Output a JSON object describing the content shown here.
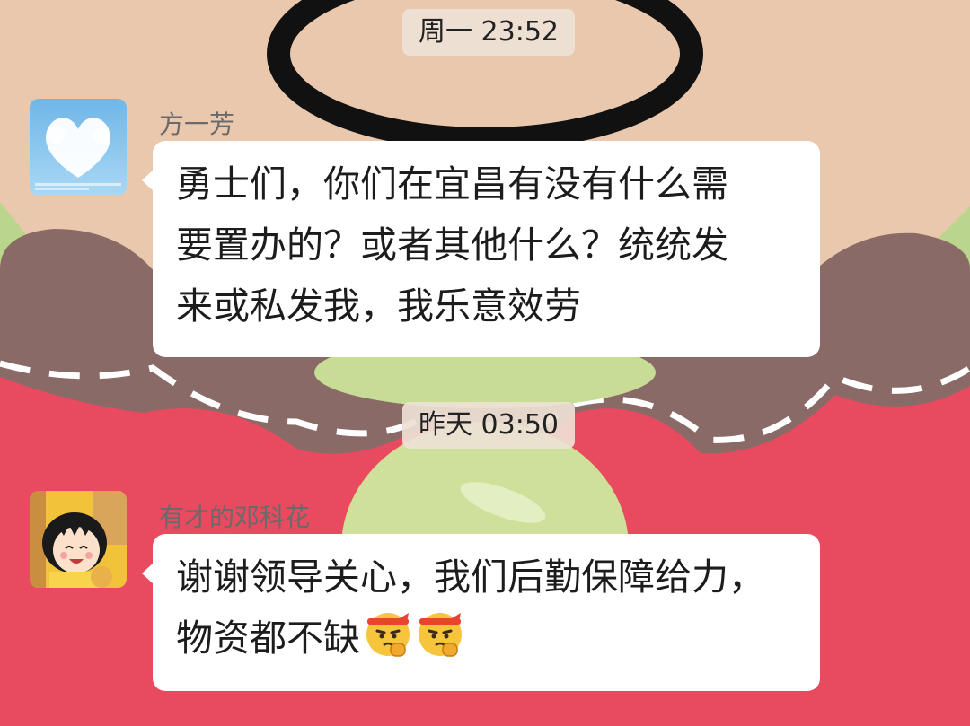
{
  "theme": {
    "pink": "#e84a60",
    "peach": "#e9c8ad",
    "brown": "#8a6a66",
    "green": "#cfe09a",
    "bubble": "#ffffff",
    "sender_color": "#6a6a6a"
  },
  "messages": [
    {
      "timestamp": "周一 23:52",
      "sender": "方一芳",
      "avatar_icon": "cloud-heart-avatar",
      "lines": [
        "勇士们，你们在宜昌有没有什么需",
        "要置办的？或者其他什么？统统发",
        "来或私发我，我乐意效劳"
      ]
    },
    {
      "timestamp": "昨天 03:50",
      "sender": "有才的邓科花",
      "avatar_icon": "cartoon-girl-avatar",
      "lines": [
        "谢谢领导关心，我们后勤保障给力，",
        "物资都不缺"
      ],
      "emojis": [
        "fist-headband-emoji",
        "fist-headband-emoji"
      ]
    }
  ]
}
